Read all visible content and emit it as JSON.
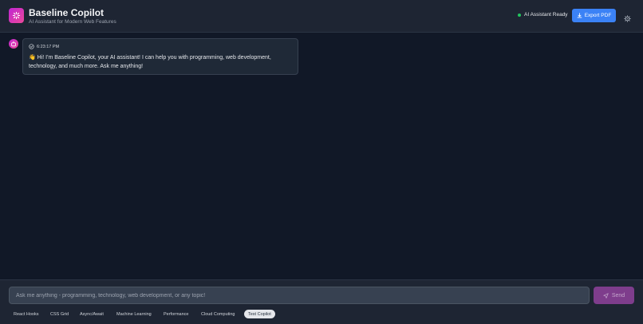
{
  "header": {
    "title": "Baseline Copilot",
    "subtitle": "AI Assistant for Modern Web Features",
    "status": "AI Assistant Ready",
    "export_label": "Export PDF"
  },
  "messages": [
    {
      "role": "assistant",
      "time": "6:23:17 PM",
      "text": "👋 Hi! I'm Baseline Copilot, your AI assistant! I can help you with programming, web development, technology, and much more. Ask me anything!"
    }
  ],
  "composer": {
    "placeholder": "Ask me anything - programming, technology, web development, or any topic!",
    "send_label": "Send"
  },
  "suggestions": [
    "React Hooks",
    "CSS Grid",
    "Async/Await",
    "Machine Learning",
    "Performance",
    "Cloud Computing",
    "Test Copilot"
  ],
  "active_suggestion": "Test Copilot",
  "colors": {
    "accent": "#3b82f6",
    "brand": "#c026d3",
    "status_ok": "#22c55e",
    "send": "#7e3d8c"
  }
}
